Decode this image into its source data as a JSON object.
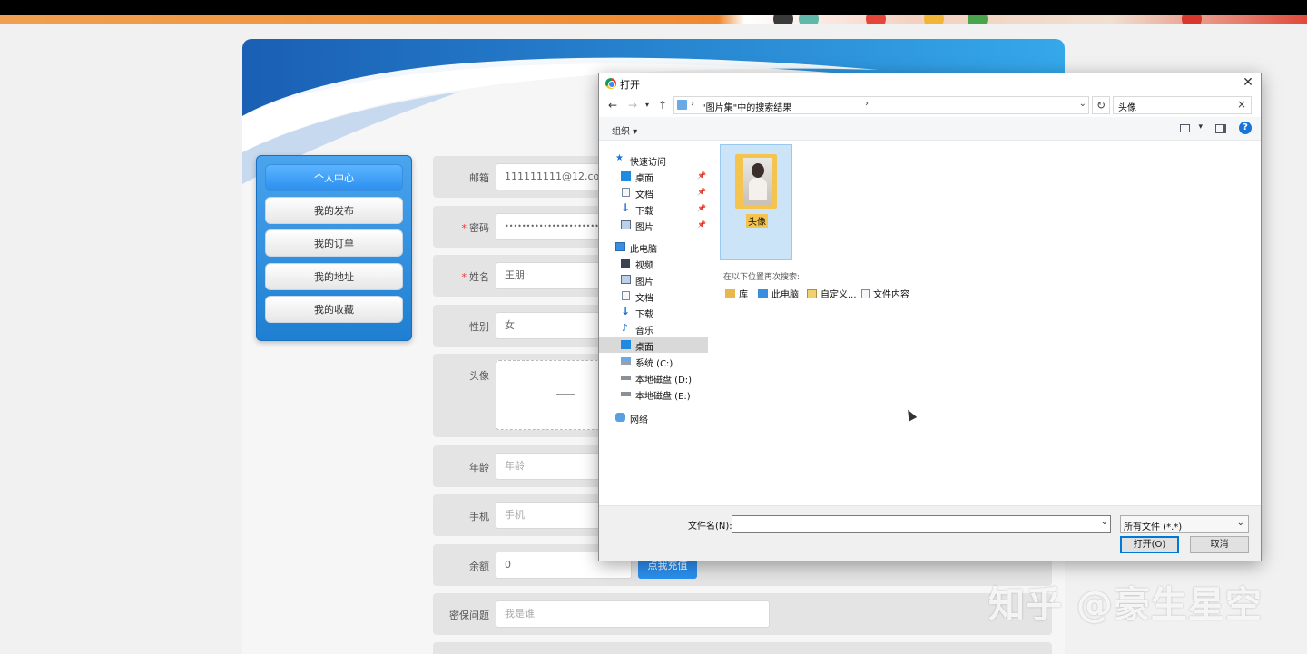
{
  "sidebar": {
    "items": [
      {
        "label": "个人中心",
        "active": true
      },
      {
        "label": "我的发布"
      },
      {
        "label": "我的订单"
      },
      {
        "label": "我的地址"
      },
      {
        "label": "我的收藏"
      }
    ]
  },
  "form": {
    "email": {
      "label": "邮箱",
      "value": "111111111@12.com"
    },
    "password": {
      "label": "密码",
      "value": "••••••••••••••••••••••••••••"
    },
    "name": {
      "label": "姓名",
      "value": "王朋"
    },
    "gender": {
      "label": "性别",
      "value": "女"
    },
    "avatar": {
      "label": "头像"
    },
    "age": {
      "label": "年龄",
      "placeholder": "年龄"
    },
    "phone": {
      "label": "手机",
      "placeholder": "手机"
    },
    "balance": {
      "label": "余额",
      "value": "0",
      "recharge_label": "点我充值"
    },
    "security_question": {
      "label": "密保问题",
      "placeholder": "我是谁"
    }
  },
  "dialog": {
    "title": "打开",
    "path": "\"图片集\"中的搜索结果",
    "search_value": "头像",
    "organize_label": "组织 ▾",
    "nav": {
      "quick_access": "快速访问",
      "quick_items": [
        "桌面",
        "文档",
        "下载",
        "图片"
      ],
      "this_pc": "此电脑",
      "pc_items": [
        "视频",
        "图片",
        "文档",
        "下载",
        "音乐",
        "桌面",
        "系统 (C:)",
        "本地磁盘 (D:)",
        "本地磁盘 (E:)"
      ],
      "network": "网络"
    },
    "file": {
      "name": "头像"
    },
    "search_again": {
      "caption": "在以下位置再次搜索:",
      "items": [
        "库",
        "此电脑",
        "自定义...",
        "文件内容"
      ]
    },
    "filename_label": "文件名(N):",
    "filename_value": "",
    "filter_value": "所有文件 (*.*)",
    "open_label": "打开(O)",
    "cancel_label": "取消"
  },
  "watermark": "知乎 @豪生星空",
  "colors": {
    "accent": "#2b8fee",
    "sidebar": "#1f7fd0",
    "required": "#e33333"
  }
}
